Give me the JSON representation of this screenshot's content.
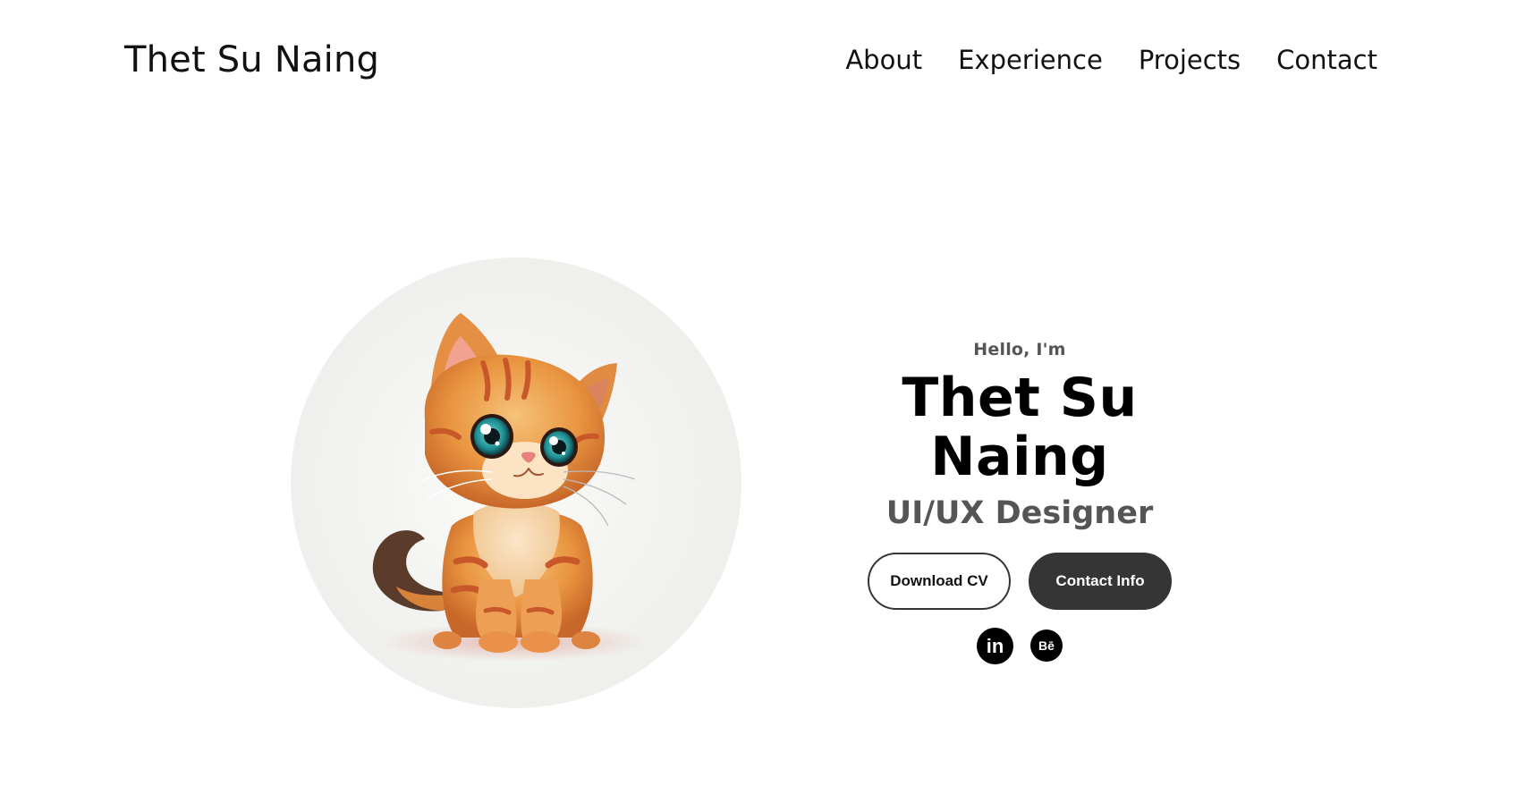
{
  "nav": {
    "logo": "Thet Su Naing",
    "links": [
      "About",
      "Experience",
      "Projects",
      "Contact"
    ]
  },
  "hero": {
    "greeting": "Hello, I'm",
    "name": "Thet Su Naing",
    "role": "UI/UX Designer",
    "buttons": {
      "download_cv": "Download CV",
      "contact_info": "Contact Info"
    },
    "socials": {
      "linkedin": {
        "icon": "linkedin-icon",
        "glyph": "in"
      },
      "behance": {
        "icon": "behance-icon",
        "glyph": "Bē"
      }
    },
    "profile_image": "kitten-illustration"
  },
  "colors": {
    "dark_button": "#353535",
    "muted_text": "#555555"
  }
}
